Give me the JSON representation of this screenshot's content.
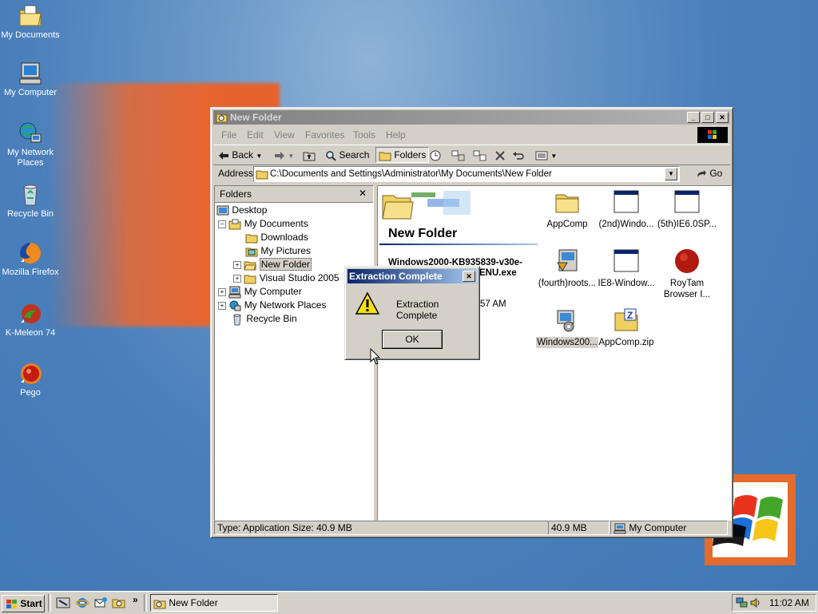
{
  "desktop": {
    "icons": [
      {
        "label": "My Documents",
        "icon": "my-documents-icon"
      },
      {
        "label": "My Computer",
        "icon": "my-computer-icon"
      },
      {
        "label": "My Network Places",
        "icon": "network-places-icon"
      },
      {
        "label": "Recycle Bin",
        "icon": "recycle-bin-icon"
      },
      {
        "label": "Mozilla Firefox",
        "icon": "firefox-icon"
      },
      {
        "label": "K-Meleon 74",
        "icon": "kmeleon-icon"
      },
      {
        "label": "Pego",
        "icon": "pego-icon"
      }
    ]
  },
  "window": {
    "title": "New Folder",
    "controls": {
      "minimize": "_",
      "maximize": "□",
      "close": "✕"
    },
    "menu": [
      "File",
      "Edit",
      "View",
      "Favorites",
      "Tools",
      "Help"
    ],
    "toolbar": {
      "back": "Back",
      "search": "Search",
      "folders": "Folders"
    },
    "address": {
      "label": "Address",
      "value": "C:\\Documents and Settings\\Administrator\\My Documents\\New Folder",
      "go": "Go"
    },
    "folders_pane": {
      "title": "Folders",
      "close": "✕",
      "tree": [
        {
          "label": "Desktop",
          "level": 0
        },
        {
          "label": "My Documents",
          "level": 1
        },
        {
          "label": "Downloads",
          "level": 2
        },
        {
          "label": "My Pictures",
          "level": 2
        },
        {
          "label": "New Folder",
          "level": 2,
          "selected": true
        },
        {
          "label": "Visual Studio 2005",
          "level": 2
        },
        {
          "label": "My Computer",
          "level": 1
        },
        {
          "label": "My Network Places",
          "level": 1
        },
        {
          "label": "Recycle Bin",
          "level": 1
        }
      ]
    },
    "files_pane": {
      "folder_title": "New Folder",
      "info_name_line1": "Windows2000-KB935839-v30e-",
      "info_name_line2": "ENU.exe",
      "info_time": "57 AM",
      "files": [
        {
          "label": "AppComp",
          "icon": "folder-icon"
        },
        {
          "label": "(2nd)Windo...",
          "icon": "application-icon"
        },
        {
          "label": "(5th)IE6.0SP...",
          "icon": "application-icon"
        },
        {
          "label": "(fourth)roots...",
          "icon": "installer-icon"
        },
        {
          "label": "IE8-Window...",
          "icon": "application-icon"
        },
        {
          "label": "RoyTam Browser I...",
          "icon": "roytam-browser-icon"
        },
        {
          "label": "Windows200...",
          "icon": "setup-icon",
          "selected": true
        },
        {
          "label": "AppComp.zip",
          "icon": "zip-folder-icon"
        }
      ]
    },
    "status": {
      "type_size": "Type: Application Size: 40.9 MB",
      "size": "40.9 MB",
      "zone": "My Computer"
    }
  },
  "dialog": {
    "title": "Extraction Complete",
    "message": "Extraction Complete",
    "ok": "OK",
    "close": "✕"
  },
  "taskbar": {
    "start": "Start",
    "task": "New Folder",
    "chevron": "»",
    "clock": "11:02 AM"
  }
}
